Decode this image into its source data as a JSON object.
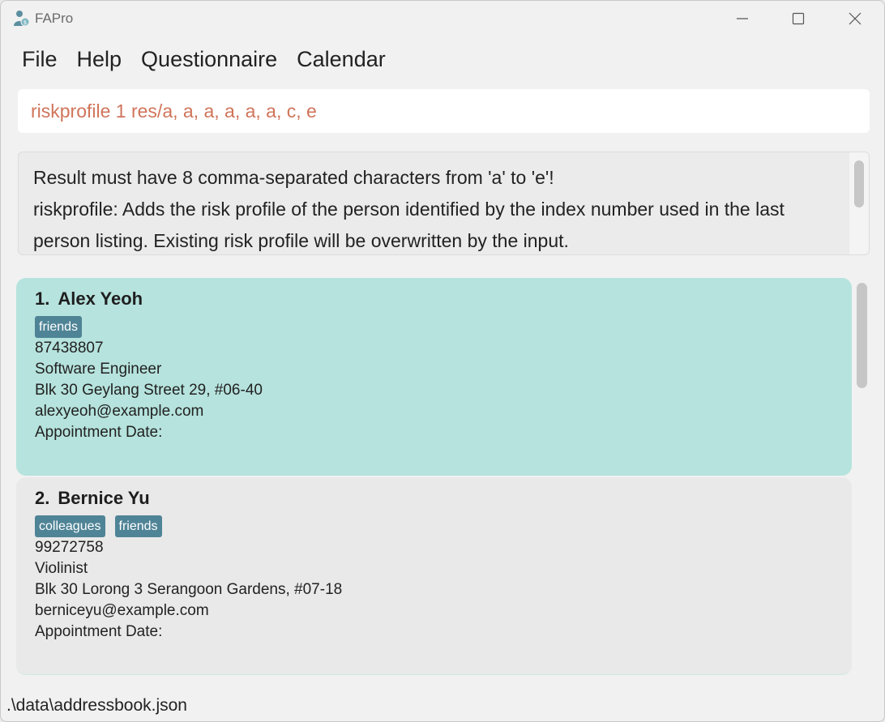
{
  "window": {
    "title": "FAPro"
  },
  "menu": {
    "items": [
      "File",
      "Help",
      "Questionnaire",
      "Calendar"
    ]
  },
  "command": {
    "value": "riskprofile 1 res/a, a, a, a, a, a, c, e"
  },
  "result": {
    "text": "Result must have 8 comma-separated characters from 'a' to 'e'!\nriskprofile: Adds the risk profile of the person identified by the index number used in the last person listing. Existing risk profile will be overwritten by the input."
  },
  "persons": [
    {
      "index": "1.",
      "name": "Alex Yeoh",
      "tags": [
        "friends"
      ],
      "phone": "87438807",
      "occupation": "Software Engineer",
      "address": "Blk 30 Geylang Street 29, #06-40",
      "email": "alexyeoh@example.com",
      "appointment": "Appointment Date:",
      "selected": true
    },
    {
      "index": "2.",
      "name": "Bernice Yu",
      "tags": [
        "colleagues",
        "friends"
      ],
      "phone": "99272758",
      "occupation": "Violinist",
      "address": "Blk 30 Lorong 3 Serangoon Gardens, #07-18",
      "email": "berniceyu@example.com",
      "appointment": "Appointment Date:",
      "selected": false
    }
  ],
  "status": {
    "file_path": ".\\data\\addressbook.json"
  },
  "colors": {
    "selected_card": "#b6e3dd",
    "tag": "#4f8496",
    "command_text": "#d0745a"
  }
}
